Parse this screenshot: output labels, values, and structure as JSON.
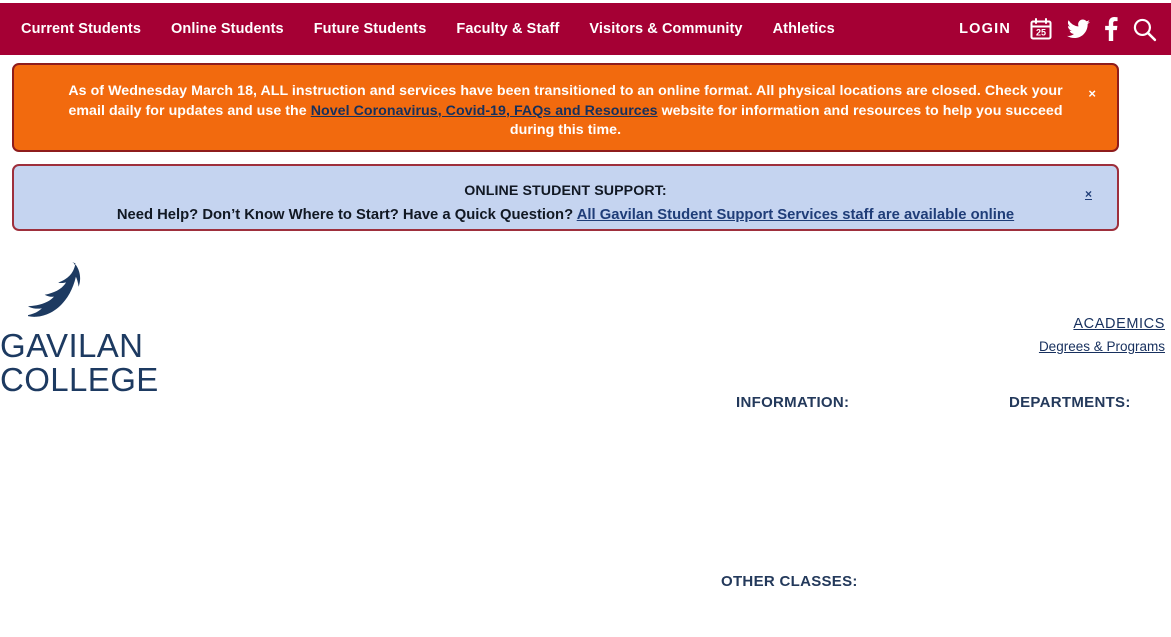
{
  "site": {
    "name": "Gavilan College",
    "logo_line1": "GAVILAN",
    "logo_line2": "COLLEGE",
    "logo_bird_icon": "hawk-bird-icon",
    "brand_maroon": "#a50034",
    "brand_navy": "#1d3a61"
  },
  "topnav": {
    "items": [
      {
        "label": "Current Students"
      },
      {
        "label": "Online Students"
      },
      {
        "label": "Future Students"
      },
      {
        "label": "Faculty & Staff"
      },
      {
        "label": "Visitors & Community"
      },
      {
        "label": "Athletics"
      }
    ],
    "login_label": "LOGIN",
    "icons": [
      {
        "name": "calendar-icon",
        "day": "25"
      },
      {
        "name": "twitter-icon"
      },
      {
        "name": "facebook-icon"
      },
      {
        "name": "search-icon"
      }
    ]
  },
  "alerts": {
    "covid": {
      "text_before_link": "As of Wednesday March 18, ALL instruction and services have been transitioned to an online format. All physical locations are closed. Check your email daily for updates and use the ",
      "link_label": "Novel Coronavirus, Covid-19, FAQs and Resources",
      "text_after_link": " website for information and resources to help you succeed during this time.",
      "close_label": "×",
      "background": "#f26a0e",
      "border": "#8e1c1c"
    },
    "support": {
      "title": "ONLINE STUDENT SUPPORT:",
      "question": "Need Help? Don’t Know Where to Start? Have a Quick Question? ",
      "link_label": "All Gavilan Student Support Services staff are available online",
      "close_label": "×",
      "background": "#c5d4f0",
      "border": "#9e2f3c"
    }
  },
  "quicklinks": {
    "academics_label": "ACADEMICS",
    "degrees_label": "Degrees & Programs"
  },
  "columns": {
    "information_heading": "INFORMATION:",
    "departments_heading": "DEPARTMENTS:",
    "other_classes_heading": "OTHER CLASSES:"
  }
}
